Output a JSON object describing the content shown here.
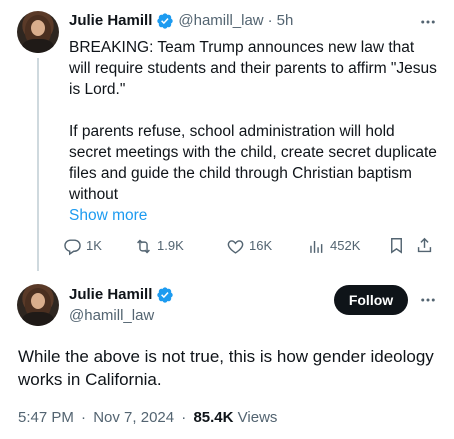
{
  "parent_tweet": {
    "display_name": "Julie Hamill",
    "handle": "@hamill_law",
    "separator": "·",
    "time_ago": "5h",
    "text_para_1": "BREAKING: Team Trump announces new law that will require students and their parents to affirm \"Jesus is Lord.\"",
    "text_para_2": "If parents refuse, school administration will hold secret meetings with the child, create secret duplicate files and guide the child through Christian baptism without",
    "show_more_label": "Show more",
    "actions": {
      "replies": "1K",
      "reposts": "1.9K",
      "likes": "16K",
      "views": "452K"
    }
  },
  "main_tweet": {
    "display_name": "Julie Hamill",
    "handle": "@hamill_law",
    "follow_label": "Follow",
    "text": "While the above is not true, this is how gender ideology works in California.",
    "time": "5:47 PM",
    "separator_1": "·",
    "date": "Nov 7, 2024",
    "separator_2": "·",
    "views_count": "85.4K",
    "views_label": "Views"
  },
  "colors": {
    "accent": "#1d9bf0",
    "text_primary": "#0f1419",
    "text_secondary": "#536471",
    "thread_line": "#cfd9de",
    "follow_bg": "#0f1419"
  },
  "icons": [
    "verified-badge-icon",
    "more-options-icon",
    "reply-icon",
    "repost-icon",
    "like-icon",
    "views-icon",
    "bookmark-icon",
    "share-icon"
  ]
}
